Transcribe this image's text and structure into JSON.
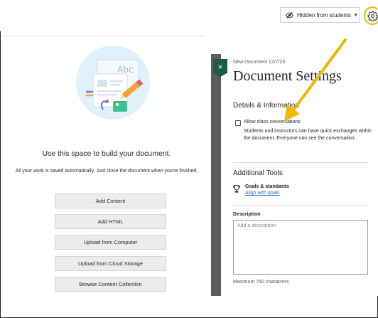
{
  "header": {
    "visibility_label": "Hidden from students",
    "visibility_caret": "▾",
    "visibility_icon": "eye-slash-icon",
    "settings_icon": "gear-icon"
  },
  "editor": {
    "illustration_text": "Abc",
    "empty_title": "Use this space to build your document.",
    "empty_subtitle": "All your work is saved automatically. Just close the document when you're finished.",
    "buttons": [
      "Add Content",
      "Add HTML",
      "Upload from Computer",
      "Upload from Cloud Storage",
      "Browse Content Collection"
    ]
  },
  "panel": {
    "close_icon": "close-icon",
    "close_glyph": "×",
    "document_name": "New Document 12/7/23",
    "title": "Document Settings",
    "details_heading": "Details & Information",
    "allow_label": "Allow class conversations",
    "allow_description": "Students and instructors can have quick exchanges within the document. Everyone can see the conversation.",
    "tools_heading": "Additional Tools",
    "goals_title": "Goals & standards",
    "goals_link": "Align with goals",
    "description_label": "Description",
    "description_placeholder": "Add a description",
    "max_chars": "Maximum 750 characters"
  },
  "colors": {
    "accent_green": "#1c5c46",
    "highlight_yellow": "#f2b705",
    "link_blue": "#2a6bc4",
    "illustration_bg": "#dff1fb"
  }
}
